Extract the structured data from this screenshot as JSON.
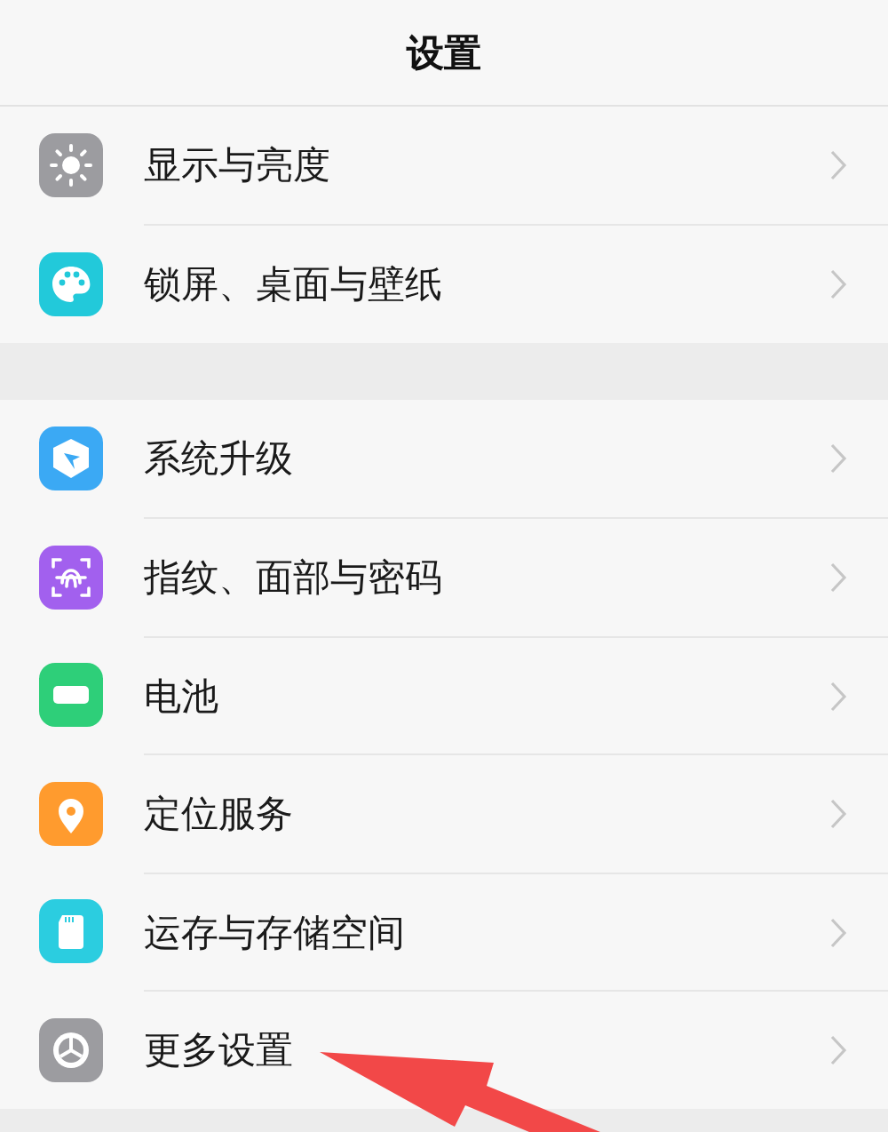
{
  "header": {
    "title": "设置"
  },
  "groups": [
    {
      "items": [
        {
          "kind": "display",
          "label": "显示与亮度"
        },
        {
          "kind": "wallpaper",
          "label": "锁屏、桌面与壁纸"
        }
      ]
    },
    {
      "items": [
        {
          "kind": "update",
          "label": "系统升级"
        },
        {
          "kind": "biometrics",
          "label": "指纹、面部与密码"
        },
        {
          "kind": "battery",
          "label": "电池"
        },
        {
          "kind": "location",
          "label": "定位服务"
        },
        {
          "kind": "storage",
          "label": "运存与存储空间"
        },
        {
          "kind": "more",
          "label": "更多设置"
        }
      ]
    }
  ],
  "annotations": [
    {
      "kind": "arrow"
    }
  ]
}
